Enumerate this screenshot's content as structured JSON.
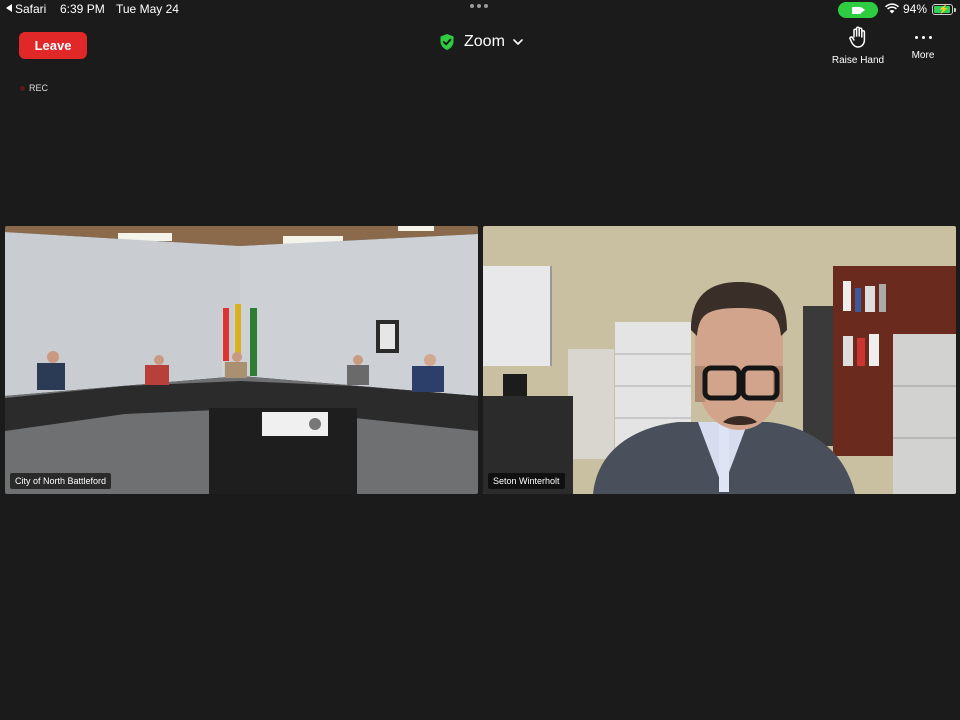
{
  "status_bar": {
    "back_app": "Safari",
    "time": "6:39 PM",
    "date": "Tue May 24",
    "battery_percent": "94%",
    "battery_level": 0.94,
    "wifi_icon": "wifi-icon",
    "camera_indicator_color": "#2ecc40"
  },
  "header": {
    "leave_label": "Leave",
    "app_title": "Zoom",
    "raise_hand_label": "Raise Hand",
    "more_label": "More",
    "rec_label": "REC"
  },
  "colors": {
    "background": "#1b1b1b",
    "leave_button": "#e02828",
    "shield": "#2ecc40"
  },
  "participants": [
    {
      "name": "City of North Battleford"
    },
    {
      "name": "Seton Winterholt"
    }
  ]
}
